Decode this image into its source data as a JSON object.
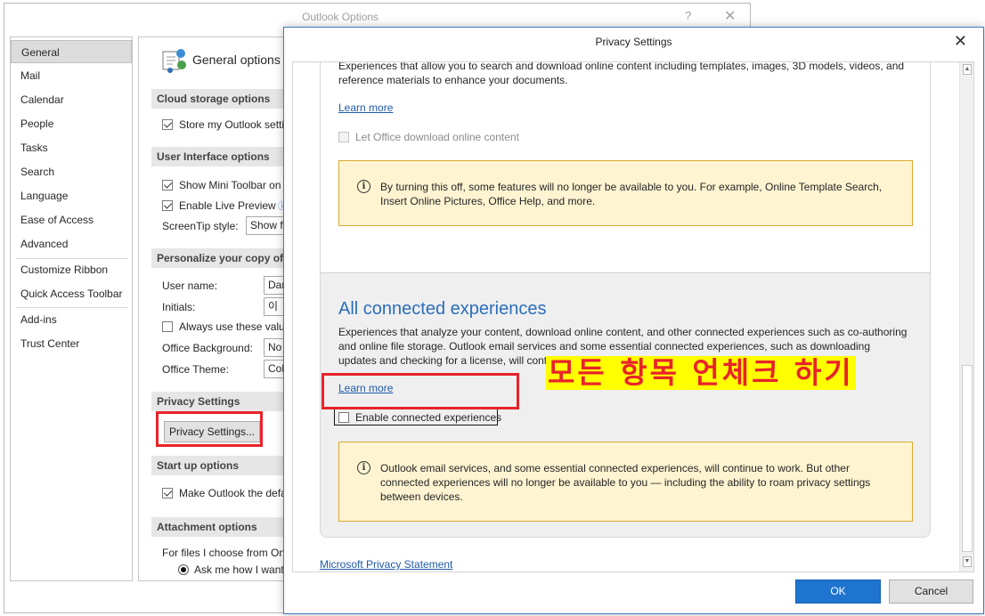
{
  "options_window": {
    "title": "Outlook Options",
    "help": "?",
    "close": "✕",
    "nav_items": [
      "General",
      "Mail",
      "Calendar",
      "People",
      "Tasks",
      "Search",
      "Language",
      "Ease of Access",
      "Advanced",
      "Customize Ribbon",
      "Quick Access Toolbar",
      "Add-ins",
      "Trust Center"
    ],
    "active_nav": "General",
    "page_title": "General options fo",
    "sections": {
      "cloud": "Cloud storage options",
      "ui": "User Interface options",
      "personalize": "Personalize your copy of M",
      "privacy": "Privacy Settings",
      "startup": "Start up options",
      "attachment": "Attachment options"
    },
    "store_outlook": "Store my Outlook setti",
    "mini_toolbar": "Show Mini Toolbar on",
    "live_preview": "Enable Live Preview",
    "screentip_label": "ScreenTip style:",
    "screentip_value": "Show fe",
    "user_name_label": "User name:",
    "user_name_value": "Dan",
    "initials_label": "Initials:",
    "initials_value": "이",
    "always_use": "Always use these value",
    "office_bg_label": "Office Background:",
    "office_bg_value": "No",
    "office_theme_label": "Office Theme:",
    "office_theme_value": "Col",
    "privacy_button": "Privacy Settings...",
    "make_default": "Make Outlook the defa",
    "for_files": "For files I choose from On",
    "ask_me": "Ask me how I want"
  },
  "privacy_dialog": {
    "title": "Privacy Settings",
    "close": "✕",
    "download_desc": "Experiences that allow you to search and download online content including templates, images, 3D models, videos, and reference materials to enhance your documents.",
    "learn_more_1": "Learn more",
    "download_checkbox": "Let Office download online content",
    "download_info": "By turning this off, some features will no longer be available to you. For example, Online Template Search, Insert Online Pictures, Office Help, and more.",
    "all_heading": "All connected experiences",
    "all_desc": "Experiences that analyze your content, download online content, and other connected experiences such as co-authoring and online file storage. Outlook email services and some essential connected experiences, such as downloading updates and checking for a license, will continue to work when this setting is disabled.",
    "learn_more_2": "Learn more",
    "enable_checkbox": "Enable connected experiences",
    "enable_checked": false,
    "all_info": "Outlook email services, and some essential connected experiences, will continue to work. But other connected experiences will no longer be available to you — including the ability to roam privacy settings between devices.",
    "privacy_statement": "Microsoft Privacy Statement",
    "ok": "OK",
    "cancel": "Cancel"
  },
  "annotation": {
    "text": "모든 항목 언체크 하기",
    "text_color": "#e8232a",
    "highlight_color": "#ffff00"
  }
}
